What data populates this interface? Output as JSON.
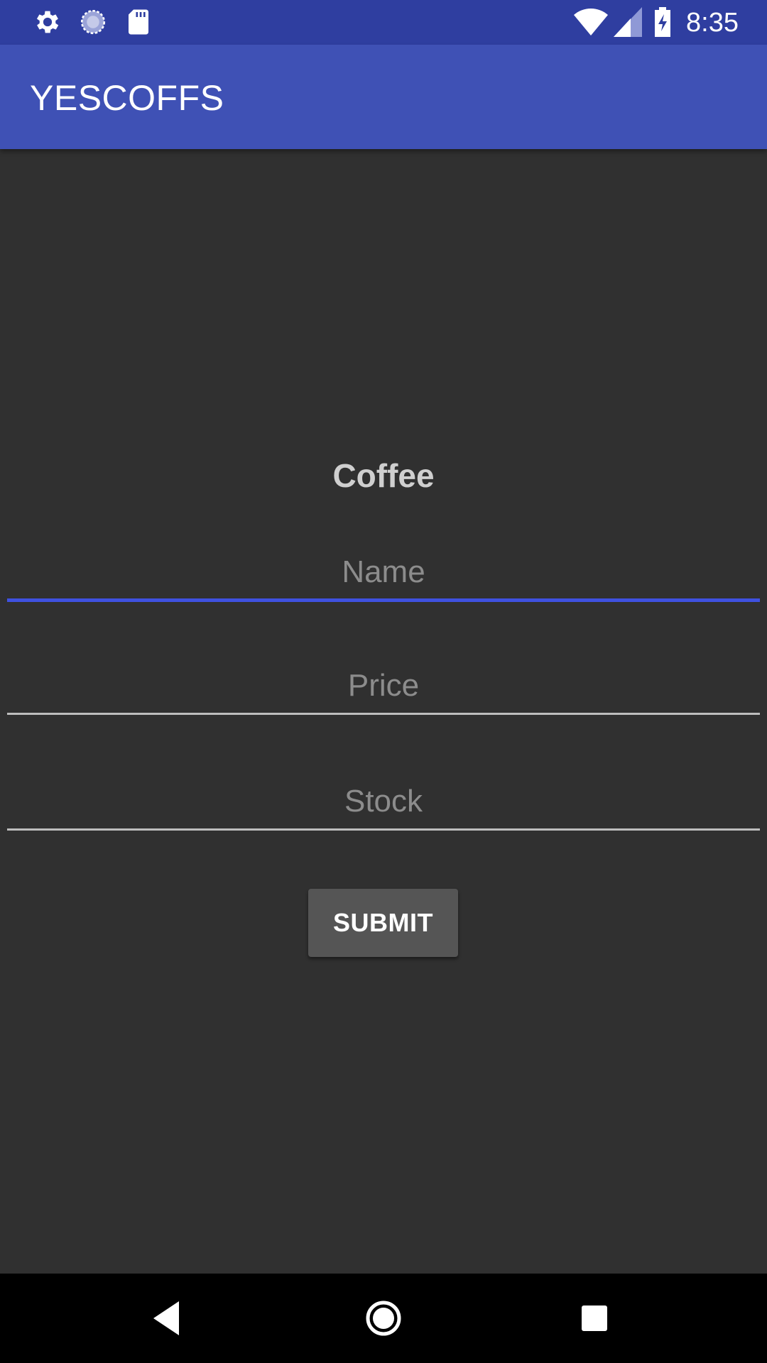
{
  "status_bar": {
    "time": "8:35",
    "icons": [
      "settings-icon",
      "sync-icon",
      "sd-card-icon",
      "wifi-icon",
      "signal-icon",
      "battery-charging-icon"
    ],
    "background": "#2f3ea0"
  },
  "app_bar": {
    "title": "YESCOFFS",
    "background": "#3f51b5"
  },
  "form": {
    "heading": "Coffee",
    "name_placeholder": "Name",
    "price_placeholder": "Price",
    "stock_placeholder": "Stock",
    "submit_label": "SUBMIT",
    "accent": "#3f51e0"
  },
  "nav_bar": {
    "icons": [
      "back-icon",
      "home-icon",
      "recents-icon"
    ]
  }
}
